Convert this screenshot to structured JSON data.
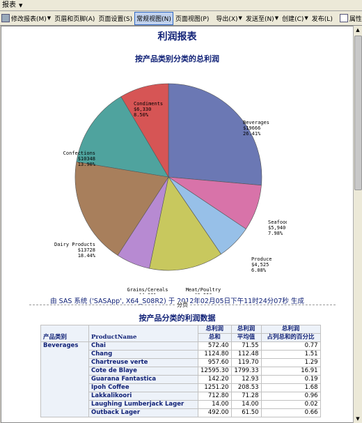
{
  "window": {
    "title": "报表"
  },
  "toolbar": {
    "items": [
      {
        "label": "修改报表(M)"
      },
      {
        "label": "页眉和页脚(A)"
      },
      {
        "label": "页面设置(S)"
      },
      {
        "label": "常规视图(N)",
        "pressed": true
      },
      {
        "label": "页面视图(P)"
      },
      {
        "label": "导出(X)"
      },
      {
        "label": "发送至(N)"
      },
      {
        "label": "创建(C)"
      },
      {
        "label": "发布(L)"
      },
      {
        "label": "属性(I)"
      }
    ]
  },
  "report": {
    "title": "利润报表",
    "chart_title": "按产品类别分类的总利润",
    "footer": "由 SAS 系统 ('SASApp', X64_S08R2) 于 2012年02月05日下午11时24分07秒 生成",
    "page_break": "分页",
    "table_title": "按产品分类的利润数据"
  },
  "chart_data": {
    "type": "pie",
    "title": "按产品类别分类的总利润",
    "slices": [
      {
        "name": "Beverages",
        "amount": "$19666",
        "pct": "26.41%",
        "value": 26.41,
        "color": "#6b78b4"
      },
      {
        "name": "Seafood",
        "amount": "$5,940",
        "pct": "7.98%",
        "value": 7.98,
        "color": "#d873a9"
      },
      {
        "name": "Produce",
        "amount": "$4,525",
        "pct": "6.08%",
        "value": 6.08,
        "color": "#97c0e8"
      },
      {
        "name": "Meat/Poultry",
        "amount": "$9,550",
        "pct": "12.82%",
        "value": 12.82,
        "color": "#c8c85e"
      },
      {
        "name": "Grains/Cereals",
        "amount": "$4,381",
        "pct": "5.88%",
        "value": 5.88,
        "color": "#b78ad2"
      },
      {
        "name": "Dairy Products",
        "amount": "$13728",
        "pct": "18.44%",
        "value": 18.44,
        "color": "#a87f5c"
      },
      {
        "name": "Confections",
        "amount": "$10348",
        "pct": "13.90%",
        "value": 13.9,
        "color": "#4fa39e"
      },
      {
        "name": "Condiments",
        "amount": "$6,330",
        "pct": "8.50%",
        "value": 8.5,
        "color": "#d65555"
      }
    ]
  },
  "table": {
    "headers": {
      "category": "产品类别",
      "product": "ProductName",
      "sum": [
        "总利润",
        "总和"
      ],
      "mean": [
        "总利润",
        "平均值"
      ],
      "pct": [
        "总利润",
        "占列总和的百分比"
      ]
    },
    "category": "Beverages",
    "rows": [
      {
        "product": "Chai",
        "sum": "572.40",
        "mean": "71.55",
        "pct": "0.77"
      },
      {
        "product": "Chang",
        "sum": "1124.80",
        "mean": "112.48",
        "pct": "1.51"
      },
      {
        "product": "Chartreuse verte",
        "sum": "957.60",
        "mean": "119.70",
        "pct": "1.29"
      },
      {
        "product": "Cote de Blaye",
        "sum": "12595.30",
        "mean": "1799.33",
        "pct": "16.91"
      },
      {
        "product": "Guarana Fantastica",
        "sum": "142.20",
        "mean": "12.93",
        "pct": "0.19"
      },
      {
        "product": "Ipoh Coffee",
        "sum": "1251.20",
        "mean": "208.53",
        "pct": "1.68"
      },
      {
        "product": "Lakkalikoori",
        "sum": "712.80",
        "mean": "71.28",
        "pct": "0.96"
      },
      {
        "product": "Laughing Lumberjack Lager",
        "sum": "14.00",
        "mean": "14.00",
        "pct": "0.02"
      },
      {
        "product": "Outback Lager",
        "sum": "492.00",
        "mean": "61.50",
        "pct": "0.66"
      }
    ]
  }
}
